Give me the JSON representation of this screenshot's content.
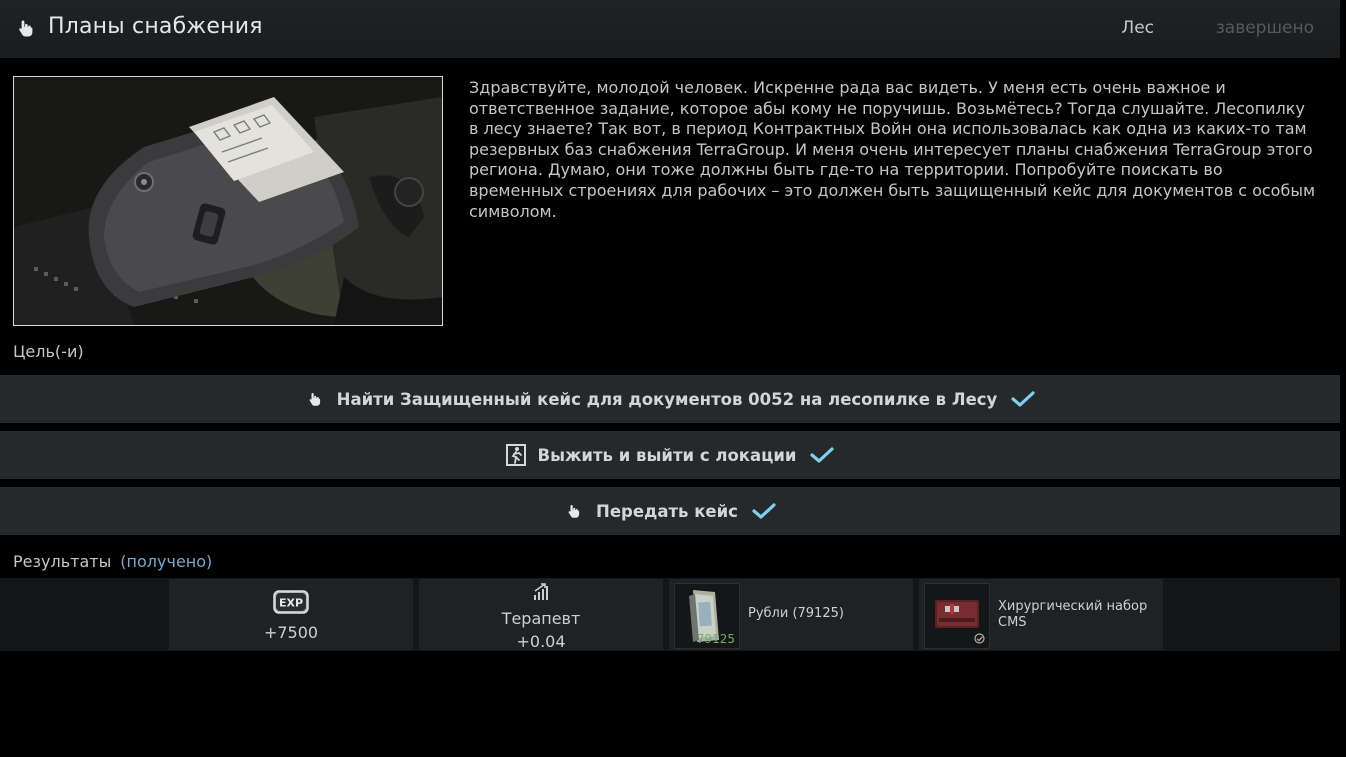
{
  "header": {
    "hand_icon": "hand-pointer-icon",
    "title": "Планы снабжения",
    "location": "Лес",
    "status": "завершено"
  },
  "description": "Здравствуйте, молодой человек. Искренне рада вас видеть. У меня есть очень важное и ответственное задание, которое абы кому не поручишь. Возьмётесь? Тогда слушайте. Лесопилку в лесу знаете? Так вот, в период Контрактных Войн она использовалась как одна из каких-то там резервных баз снабжения TerraGroup. И меня очень интересует планы снабжения TerraGroup этого региона. Думаю, они тоже должны быть где-то на территории. Попробуйте поискать во временных строениях для рабочих – это должен быть защищенный кейс для документов с особым символом.",
  "goals_label": "Цель(-и)",
  "objectives": [
    {
      "icon": "hand-pointer-icon",
      "text": "Найти Защищенный кейс для документов 0052 на лесопилке в Лесу",
      "completed": true
    },
    {
      "icon": "exit-door-icon",
      "text": "Выжить и выйти с локации",
      "completed": true
    },
    {
      "icon": "hand-pointer-icon",
      "text": "Передать кейс",
      "completed": true
    }
  ],
  "results": {
    "label": "Результаты",
    "received": "(получено)"
  },
  "rewards": {
    "exp": {
      "icon": "exp-badge-icon",
      "badge_text": "EXP",
      "value": "+7500"
    },
    "skill": {
      "icon": "skill-level-icon",
      "name": "Терапевт",
      "value": "+0.04"
    },
    "roubles": {
      "icon": "roubles-stack-icon",
      "count": "79125",
      "name": "Рубли (79125)"
    },
    "item": {
      "icon": "surgical-kit-icon",
      "name": "Хирургический набор CMS",
      "found_in_raid": true
    }
  },
  "colors": {
    "check": "#7fd0ec",
    "received_link": "#7fa6c9",
    "status_done": "#555a5c",
    "objective_bg": "#26292b"
  }
}
